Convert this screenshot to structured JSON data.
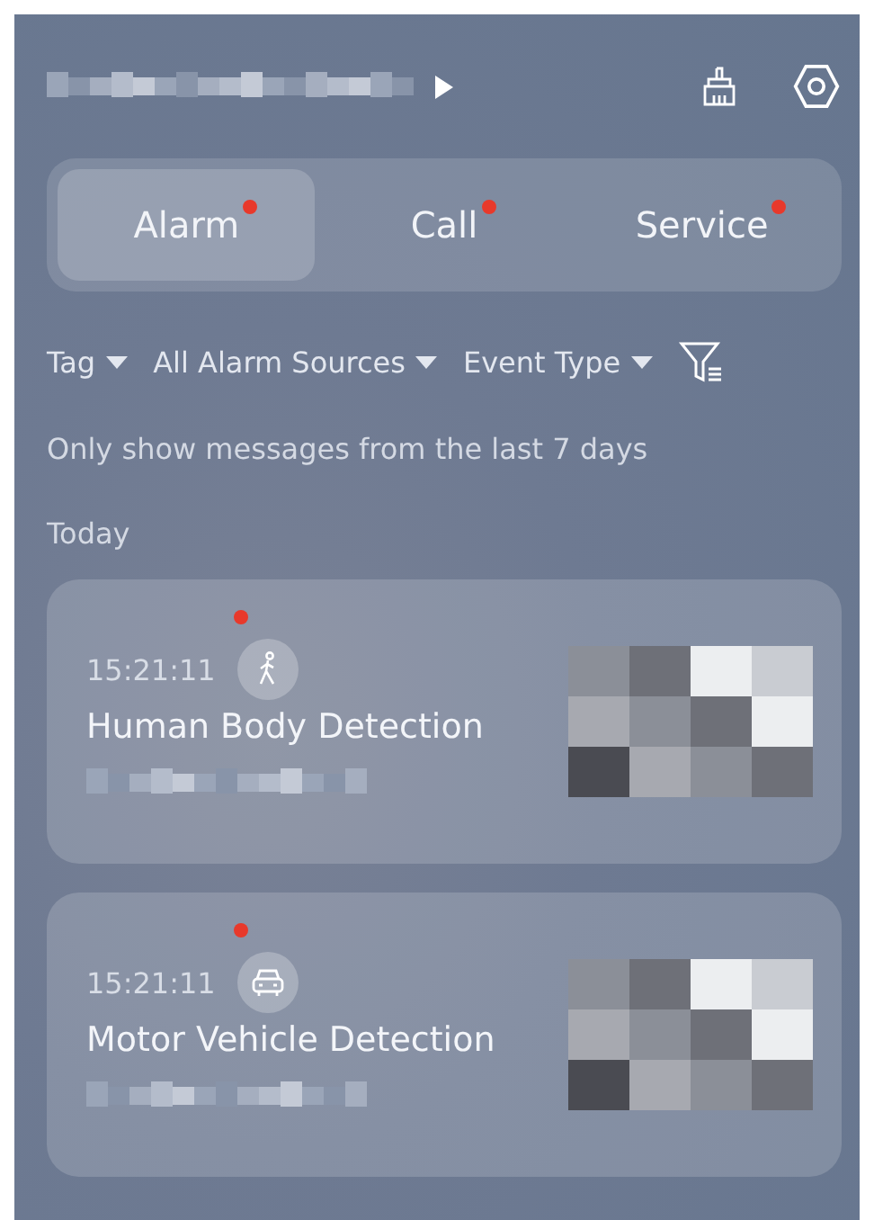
{
  "tabs": [
    {
      "label": "Alarm",
      "selected": true,
      "unread": true
    },
    {
      "label": "Call",
      "selected": false,
      "unread": true
    },
    {
      "label": "Service",
      "selected": false,
      "unread": true
    }
  ],
  "filters": [
    {
      "label": "Tag"
    },
    {
      "label": "All Alarm Sources"
    },
    {
      "label": "Event Type"
    }
  ],
  "notice": "Only show messages from the last 7 days",
  "section": "Today",
  "events": [
    {
      "time": "15:21:11",
      "title": "Human Body Detection",
      "kind": "human",
      "unread": true
    },
    {
      "time": "15:21:11",
      "title": "Motor Vehicle Detection",
      "kind": "vehicle",
      "unread": true
    }
  ]
}
